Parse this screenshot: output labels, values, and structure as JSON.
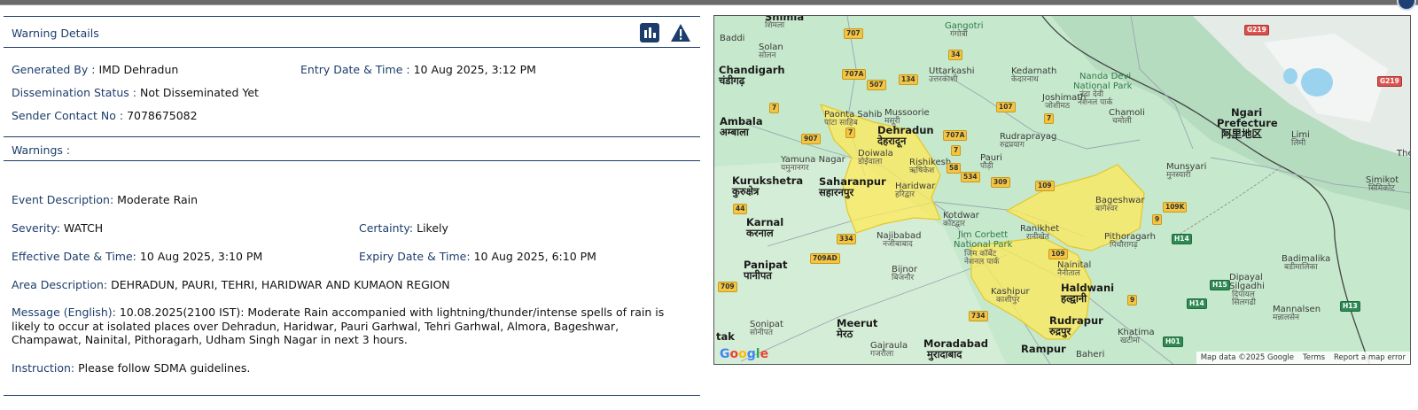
{
  "header": {
    "title": "Warning Details"
  },
  "icons": {
    "chart": "bar-chart-icon",
    "warning": "warning-triangle-icon"
  },
  "details": {
    "generated_by_label": "Generated By :",
    "generated_by": "IMD Dehradun",
    "entry_label": "Entry Date & Time :",
    "entry_value": "10 Aug 2025, 3:12 PM",
    "dissemination_label": "Dissemination Status :",
    "dissemination_value": "Not Disseminated Yet",
    "sender_label": "Sender Contact No :",
    "sender_value": "7078675082"
  },
  "warnings": {
    "section_label": "Warnings :",
    "event_label": "Event Description:",
    "event_value": "Moderate Rain",
    "severity_label": "Severity:",
    "severity_value": "WATCH",
    "certainty_label": "Certainty:",
    "certainty_value": "Likely",
    "effective_label": "Effective Date & Time:",
    "effective_value": "10 Aug 2025, 3:10 PM",
    "expiry_label": "Expiry Date & Time:",
    "expiry_value": "10 Aug 2025, 6:10 PM",
    "area_label": "Area Description:",
    "area_value": "DEHRADUN, PAURI, TEHRI, HARIDWAR AND KUMAON REGION",
    "message_label": "Message (English):",
    "message_value": "10.08.2025(2100 IST): Moderate Rain accompanied with lightning/thunder/intense spells of rain is likely to occur at isolated places over Dehradun, Haridwar, Pauri Garhwal, Tehri Garhwal, Almora, Bageshwar, Champawat, Nainital, Pithoragarh, Udham Singh Nagar in next 3 hours.",
    "instruction_label": "Instruction:",
    "instruction_value": "Please follow SDMA guidelines."
  },
  "map": {
    "attribution": "Map data ©2025 Google",
    "terms": "Terms",
    "report": "Report a map error",
    "google_letters": [
      "G",
      "o",
      "o",
      "g",
      "l",
      "e"
    ],
    "places": {
      "shimla": "Shimla",
      "shimla_local": "शिमला",
      "baddi": "Baddi",
      "solan": "Solan",
      "solan_local": "सोलन",
      "chandigarh": "Chandigarh",
      "chandigarh_local": "चंडीगढ़",
      "ambala": "Ambala",
      "ambala_local": "अम्बाला",
      "kurukshetra": "Kurukshetra",
      "kurukshetra_local": "कुरुक्षेत्र",
      "karnal": "Karnal",
      "karnal_local": "करनाल",
      "panipat": "Panipat",
      "panipat_local": "पानीपत",
      "sonipat": "Sonipat",
      "sonipat_local": "सोनीपत",
      "meerut": "Meerut",
      "meerut_local": "मेरठ",
      "gajraula": "Gajraula",
      "gajraula_local": "गजरौला",
      "moradabad": "Moradabad",
      "moradabad_local": "मुरादाबाद",
      "rampur": "Rampur",
      "baheri": "Baheri",
      "bijnor": "Bijnor",
      "bijnor_local": "बिजनौर",
      "najibabad": "Najibabad",
      "najibabad_local": "नजीबाबाद",
      "saharanpur": "Saharanpur",
      "saharanpur_local": "सहारनपुर",
      "yamuna_nagar": "Yamuna Nagar",
      "yamuna_nagar_local": "यमुनानगर",
      "paonta": "Paonta Sahib",
      "paonta_local": "पांटा साहिब",
      "dehradun": "Dehradun",
      "dehradun_local": "देहरादून",
      "mussoorie": "Mussoorie",
      "mussoorie_local": "मसूरी",
      "doiwala": "Doiwala",
      "doiwala_local": "डोईवाला",
      "rishikesh": "Rishikesh",
      "rishikesh_local": "ऋषिकेश",
      "haridwar": "Haridwar",
      "haridwar_local": "हरिद्वार",
      "kotdwar": "Kotdwar",
      "kotdwar_local": "कोटद्वार",
      "uttarkashi": "Uttarkashi",
      "uttarkashi_local": "उत्तरकाशी",
      "gangotri": "Gangotri",
      "gangotri_local": "गंगोत्री",
      "kedarnath": "Kedarnath",
      "kedarnath_local": "केदारनाथ",
      "joshimath": "Joshimath",
      "joshimath_local": "जोशीमठ",
      "nanda_devi": "Nanda Devi",
      "national_park": "National Park",
      "nanda_devi_local": "नंदा देवी",
      "national_park_local": "नेशनल पार्क",
      "chamoli": "Chamoli",
      "chamoli_local": "चमोली",
      "rudraprayag": "Rudraprayag",
      "rudraprayag_local": "रुद्रप्रयाग",
      "pauri": "Pauri",
      "pauri_local": "पौड़ी",
      "ranikhet": "Ranikhet",
      "ranikhet_local": "रानीखेत",
      "jim_corbett": "Jim Corbett",
      "jim_corbett_np": "National Park",
      "jim_corbett_local": "जिम कॉर्बेट",
      "jim_corbett_local2": "नेशनल पार्क",
      "nainital": "Nainital",
      "nainital_local": "नैनीताल",
      "haldwani": "Haldwani",
      "haldwani_local": "हल्द्वानी",
      "kashipur": "Kashipur",
      "kashipur_local": "काशीपुर",
      "rudrapur": "Rudrapur",
      "rudrapur_local": "रुद्रपुर",
      "khatima": "Khatima",
      "khatima_local": "खटीमा",
      "bageshwar": "Bageshwar",
      "bageshwar_local": "बागेश्वर",
      "pithoragarh": "Pithoragarh",
      "pithoragarh_local": "पिथौरागढ़",
      "munsyari": "Munsyari",
      "munsyari_local": "मुनस्यारी",
      "ngari": "Ngari",
      "prefecture": "Prefecture",
      "ngari_local": "阿里地区",
      "limi": "Limi",
      "limi_local": "लिमी",
      "simikot": "Simikot",
      "simikot_local": "सिमिकोट",
      "badimalika": "Badimalika",
      "badimalika_local": "बडीमालिका",
      "dipayal": "Dipayal",
      "silgadhi": "Silgadhi",
      "dipayal_local": "दिपायल",
      "silgadhi_local": "सिलगढी",
      "mannalsen": "Mannalsen",
      "mannalsen_local": "मन्नालसेन",
      "tak": "tak",
      "the": "The"
    },
    "shields": {
      "r707": "707",
      "r707a": "707A",
      "r507": "507",
      "r134": "134",
      "r34": "34",
      "r7a": "7",
      "r907": "907",
      "r7b": "7",
      "r107": "107",
      "r7c": "7",
      "r707a2": "707A",
      "r7d": "7",
      "r58": "58",
      "r534": "534",
      "r309": "309",
      "r109": "109",
      "r9a": "9",
      "r109k": "109K",
      "r44": "44",
      "r334": "334",
      "r709ad": "709AD",
      "r709": "709",
      "r734": "734",
      "r109b": "109",
      "r9b": "9",
      "g219a": "G219",
      "g219b": "G219",
      "h14a": "H14",
      "h14b": "H14",
      "h15": "H15",
      "h13": "H13",
      "h01": "H01"
    }
  }
}
